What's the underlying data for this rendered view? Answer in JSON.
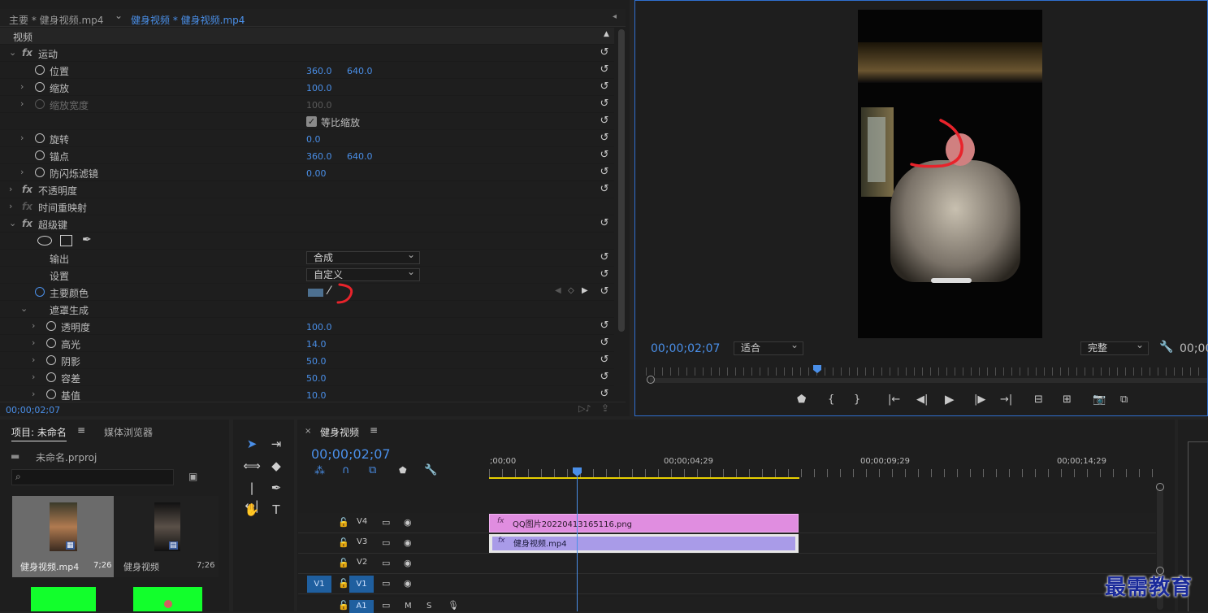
{
  "effect_controls": {
    "tab_master": "主要 * 健身视频.mp4",
    "tab_clip": "健身视频 * 健身视频.mp4",
    "section_video": "视频",
    "motion": {
      "label": "运动",
      "position": {
        "label": "位置",
        "x": "360.0",
        "y": "640.0"
      },
      "scale": {
        "label": "缩放",
        "value": "100.0"
      },
      "scale_width": {
        "label": "缩放宽度",
        "value": "100.0"
      },
      "uniform_scale": {
        "label": "等比缩放",
        "checked": true
      },
      "rotation": {
        "label": "旋转",
        "value": "0.0"
      },
      "anchor": {
        "label": "锚点",
        "x": "360.0",
        "y": "640.0"
      },
      "anti_flicker": {
        "label": "防闪烁滤镜",
        "value": "0.00"
      }
    },
    "opacity": "不透明度",
    "time_remap": "时间重映射",
    "ultra_key": {
      "label": "超级键",
      "output": {
        "label": "输出",
        "value": "合成"
      },
      "setting": {
        "label": "设置",
        "value": "自定义"
      },
      "key_color": {
        "label": "主要颜色",
        "color": "#4d7090"
      },
      "matte_generation": {
        "label": "遮罩生成",
        "transparency": {
          "label": "透明度",
          "value": "100.0"
        },
        "highlight": {
          "label": "高光",
          "value": "14.0"
        },
        "shadow": {
          "label": "阴影",
          "value": "50.0"
        },
        "tolerance": {
          "label": "容差",
          "value": "50.0"
        },
        "pedestal": {
          "label": "基值",
          "value": "10.0"
        }
      }
    },
    "timecode": "00;00;02;07"
  },
  "program_monitor": {
    "timecode": "00;00;02;07",
    "fit": "适合",
    "resolution": "完整",
    "timecode_right": "00;00"
  },
  "project": {
    "tab_project": "项目: 未命名",
    "tab_media": "媒体浏览器",
    "file_name": "未命名.prproj",
    "items": [
      {
        "name": "健身视频.mp4",
        "duration": "7;26"
      },
      {
        "name": "健身视频",
        "duration": "7;26"
      }
    ]
  },
  "timeline": {
    "tab": "健身视频",
    "timecode": "00;00;02;07",
    "ruler": [
      ";00;00",
      "00;00;04;29",
      "00;00;09;29",
      "00;00;14;29"
    ],
    "tracks": [
      "V4",
      "V3",
      "V2",
      "V1",
      "A1"
    ],
    "source_patch_v1": "V1",
    "clip_png": "QQ图片20220413165116.png",
    "clip_video": "健身视频.mp4",
    "track_a1_m": "M",
    "track_a1_s": "S"
  },
  "watermark": "最需教育",
  "colors": {
    "accent": "#4a8fe8",
    "png_clip": "#e08de0",
    "video_clip": "#a99be8",
    "work_area": "#e8d000"
  }
}
